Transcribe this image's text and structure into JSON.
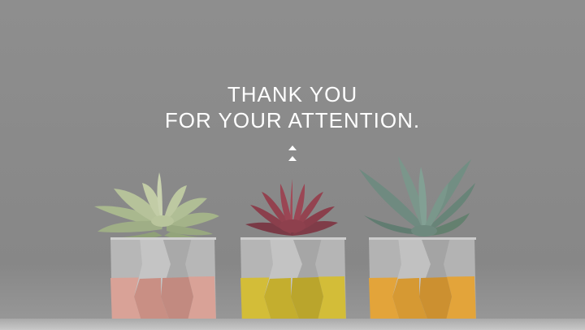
{
  "slide": {
    "title_line_1": "THANK YOU",
    "title_line_2": "FOR YOUR ATTENTION."
  },
  "decor": {
    "icons": [
      "double-up-triangle-icon"
    ],
    "pots": [
      {
        "plant": "pale-green-succulent",
        "band_color": "#e6a99d"
      },
      {
        "plant": "red-succulent",
        "band_color": "#e3c93c"
      },
      {
        "plant": "aloe-succulent",
        "band_color": "#efae3a"
      }
    ]
  },
  "colors": {
    "background": "#8a8a8a",
    "text": "#ffffff"
  }
}
